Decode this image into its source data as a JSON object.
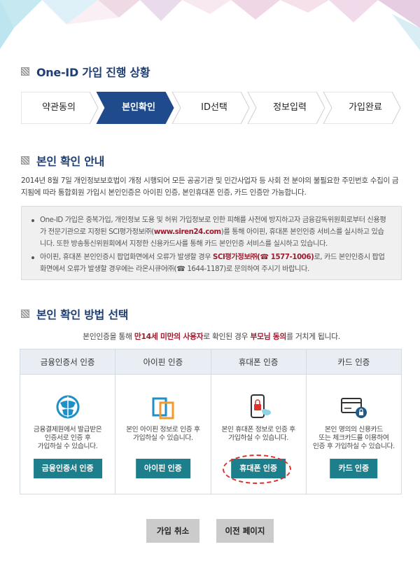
{
  "progress": {
    "title": "One-ID 가입 진행 상황",
    "steps": [
      {
        "label": "약관동의",
        "active": false
      },
      {
        "label": "본인확인",
        "active": true
      },
      {
        "label": "ID선택",
        "active": false
      },
      {
        "label": "정보입력",
        "active": false
      },
      {
        "label": "가입완료",
        "active": false
      }
    ]
  },
  "guide": {
    "title": "본인 확인 안내",
    "intro": "2014년 8월 7일 개인정보보호법이 개정 시행되어 모든 공공기관 및 민간사업자 등 사회 전 분야의 불필요한 주민번호 수집이 금지됨에 따라 통합회원 가입시 본인인증은 아이핀 인증, 본인휴대폰 인증, 카드 인증만 가능합니다.",
    "notice_items": [
      {
        "text_before": "One-ID 가입은 중복가입, 개인정보 도용 및 허위 가입정보로 인한 피해를 사전에 방지하고자 금융감독위원회로부터 신용평가 전문기관으로 지정된 SCI평가정보㈜(",
        "highlight": "www.siren24.com",
        "text_after": ")를 통해 아이핀, 휴대폰 본인인증 서비스를 실시하고 있습니다. 또한 방송통신위원회에서 지정한 신용카드사를 통해 카드 본인인증 서비스를 실시하고 있습니다."
      },
      {
        "text_before": "아이핀, 휴대폰 본인인증시 팝업화면에서 오류가 발생할 경우 ",
        "highlight": "SCI평가정보㈜(☎ 1577-1006)",
        "text_after": "로, 카드 본인인증시 팝업화면에서 오류가 발생할 경우에는 라온시큐어㈜(☎ 1644-1187)로 문의하여 주시기 바랍니다."
      }
    ]
  },
  "method": {
    "title": "본인 확인 방법 선택",
    "subtext_before": "본인인증을 통해 ",
    "subtext_hl1": "만14세 미만의 사용자",
    "subtext_mid": "로 확인된 경우 ",
    "subtext_hl2": "부모님 동의",
    "subtext_after": "를 거치게 됩니다.",
    "options": [
      {
        "header": "금융인증서 인증",
        "desc": "금융결제원에서 발급받은\n인증서로 인증 후\n가입하실 수 있습니다.",
        "button": "금융인증서 인증",
        "icon": "globe-icon"
      },
      {
        "header": "아이핀 인증",
        "desc": "본인 아이핀 정보로 인증 후\n가입하실 수 있습니다.",
        "button": "아이핀 인증",
        "icon": "ipin-icon"
      },
      {
        "header": "휴대폰 인증",
        "desc": "본인 휴대폰 정보로 인증 후\n가입하실 수 있습니다.",
        "button": "휴대폰 인증",
        "icon": "phone-lock-icon"
      },
      {
        "header": "카드 인증",
        "desc": "본인 명의의 신용카드\n또는 체크카드를 이용하여\n인증 후 가입하실 수 있습니다.",
        "button": "카드 인증",
        "icon": "card-lock-icon"
      }
    ]
  },
  "buttons": {
    "cancel": "가입 취소",
    "previous": "이전 페이지"
  },
  "colors": {
    "title": "#1f3f73",
    "active_step": "#1f4a8c",
    "highlight": "#9b1c2f",
    "method_button": "#1e7f8c",
    "gray_button": "#cbcbcb",
    "highlight_oval": "#e0312b"
  }
}
